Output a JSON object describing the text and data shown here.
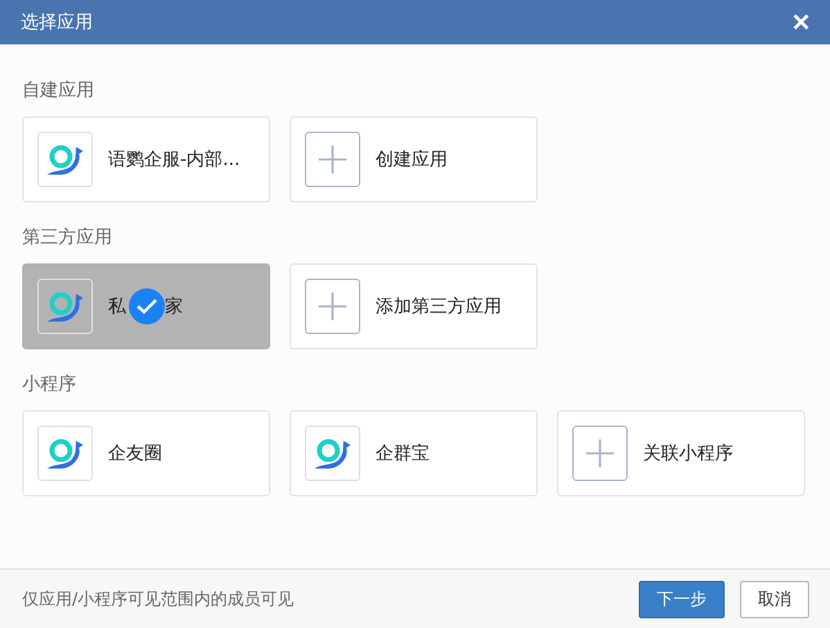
{
  "window": {
    "title": "选择应用",
    "close": "✕"
  },
  "sections": [
    {
      "title": "自建应用",
      "items": [
        {
          "kind": "app",
          "name": "语鹦企服-内部...",
          "selected": false
        },
        {
          "kind": "add",
          "name": "创建应用",
          "selected": false
        }
      ]
    },
    {
      "title": "第三方应用",
      "items": [
        {
          "kind": "app",
          "name_parts": [
            "私",
            "家"
          ],
          "selected": true
        },
        {
          "kind": "add",
          "name": "添加第三方应用",
          "selected": false
        }
      ]
    },
    {
      "title": "小程序",
      "items": [
        {
          "kind": "app",
          "name": "企友圈",
          "selected": false
        },
        {
          "kind": "app",
          "name": "企群宝",
          "selected": false
        },
        {
          "kind": "add",
          "name": "关联小程序",
          "selected": false
        }
      ]
    }
  ],
  "footer": {
    "note": "仅应用/小程序可见范围内的成员可见",
    "buttons": [
      {
        "kind": "primary",
        "label": "下一步"
      },
      {
        "kind": "default",
        "label": "取消"
      }
    ]
  }
}
